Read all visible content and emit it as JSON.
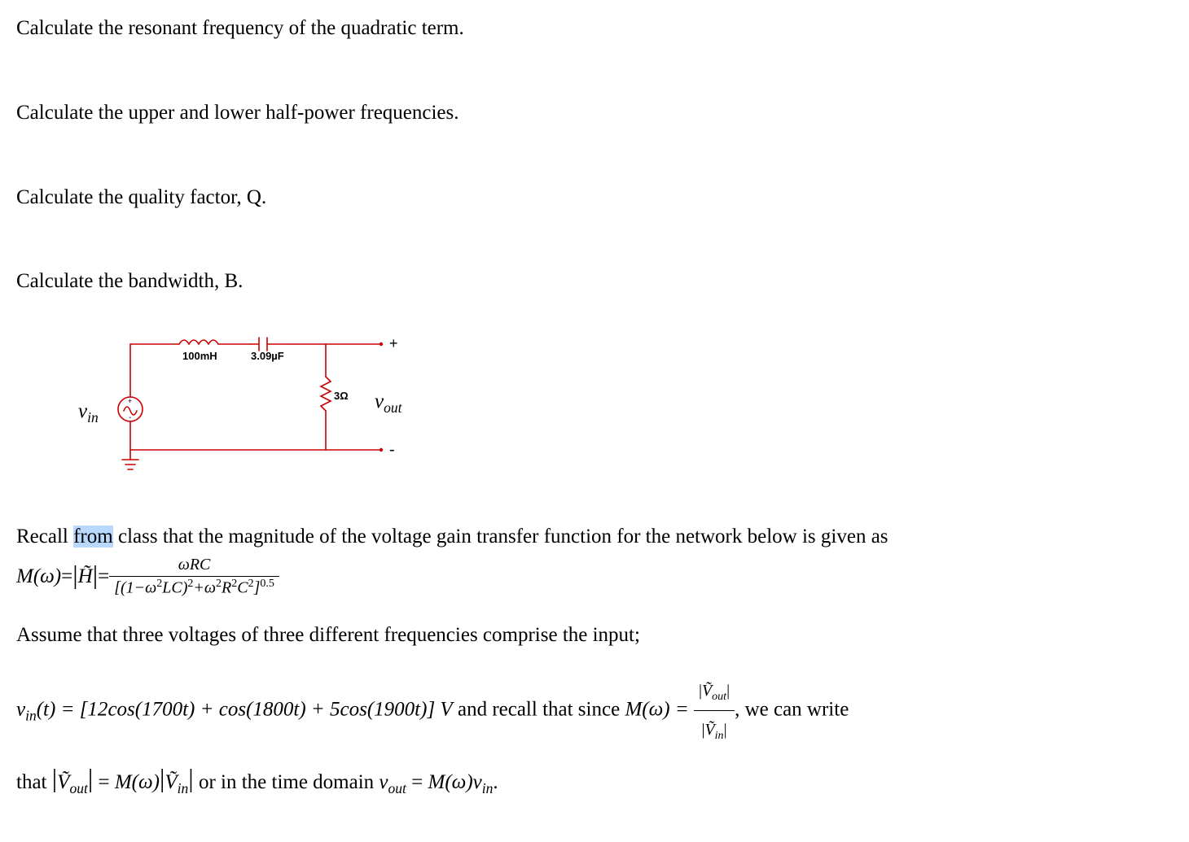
{
  "questions": {
    "q1": "Calculate the resonant frequency of the quadratic term.",
    "q2": "Calculate the upper and lower half-power frequencies.",
    "q3": "Calculate the quality factor, Q.",
    "q4": "Calculate the bandwidth, B."
  },
  "circuit": {
    "inductor_label": "100mH",
    "capacitor_label": "3.09µF",
    "resistor_label": "3Ω",
    "vin_label_v": "v",
    "vin_label_sub": "in",
    "vout_label_v": "v",
    "vout_label_sub": "out",
    "plus": "+",
    "minus": "-"
  },
  "recall": {
    "prefix": "Recall ",
    "highlighted": "from",
    "rest": " class that the magnitude of the voltage gain transfer function for the network below is given as"
  },
  "mag_eq": {
    "lhs_M": "M",
    "lhs_omega": "(ω)",
    "eq1": " = ",
    "abs_H": "H̃",
    "eq2": " = ",
    "num": "ωRC",
    "den_open": "[(1−ω",
    "den_sq1": "2",
    "den_mid1": "LC)",
    "den_sq2": "2",
    "den_mid2": "+ω",
    "den_sq3": "2",
    "den_mid3": "R",
    "den_sq4": "2",
    "den_mid4": "C",
    "den_sq5": "2",
    "den_close": "]",
    "den_exp": "0.5"
  },
  "assume": "Assume that three voltages of three different frequencies comprise the input;",
  "vin_eq": {
    "v": "v",
    "in": "in",
    "t": "(t) = [12",
    "cos": "cos",
    "arg1": "(1700t) + ",
    "arg2": "(1800t) + 5",
    "arg3": "(1900t)] V",
    "recall": " and recall that since ",
    "M": "M",
    "omega": "(ω) = ",
    "Vtilde_out": "Ṽ",
    "out": "out",
    "Vtilde_in": "Ṽ",
    "insub": "in",
    "comma": ", we can write",
    "line2a": "that ",
    "eq": " = ",
    "M2": "M",
    "omega2": "(ω)",
    "or": " or in the time domain ",
    "vout_v": "v",
    "vout_sub": "out",
    "eq2": " = ",
    "M3": "M",
    "omega3": "(ω)",
    "vin_v": "v",
    "vin_sub": "in",
    "period": "."
  }
}
